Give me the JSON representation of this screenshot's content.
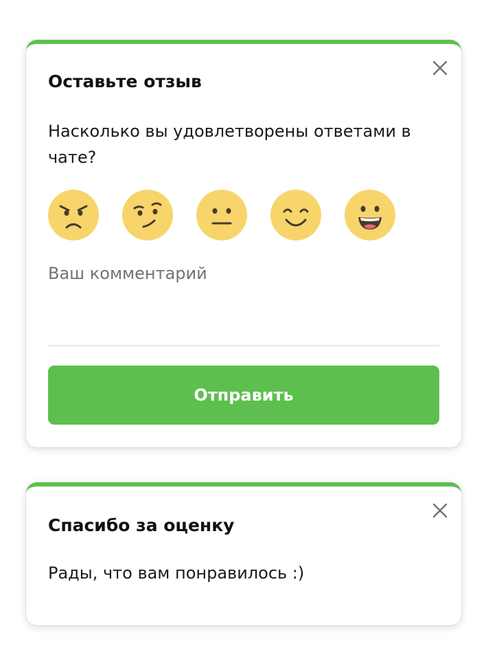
{
  "colors": {
    "accent": "#5dbf4e",
    "emoji_face": "#f7d56b",
    "emoji_features": "#4a3b2a",
    "close_icon": "#6e7279"
  },
  "feedback": {
    "title": "Оставьте отзыв",
    "question": "Насколько вы удовлетворены ответами в чате?",
    "emojis": [
      "angry-face-icon",
      "skeptical-face-icon",
      "neutral-face-icon",
      "smiling-face-icon",
      "grinning-face-icon"
    ],
    "comment_placeholder": "Ваш комментарий",
    "comment_value": "",
    "submit_label": "Отправить"
  },
  "thanks": {
    "title": "Спасибо за оценку",
    "message": "Рады, что вам понравилось :)"
  }
}
